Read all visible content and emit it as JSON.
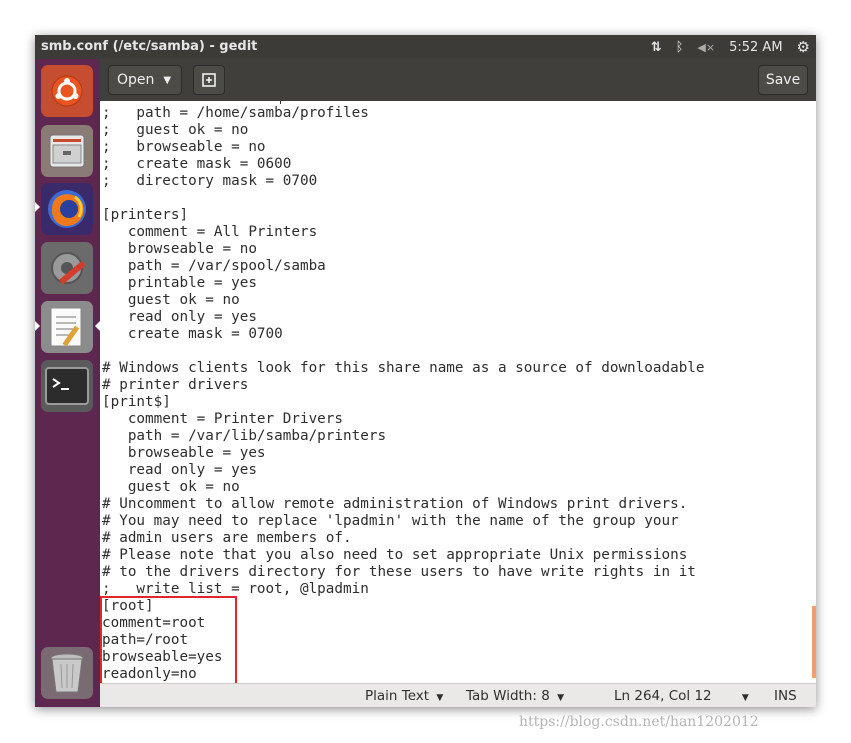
{
  "window": {
    "title": "smb.conf (/etc/samba) - gedit"
  },
  "tray": {
    "network_icon": "⇅",
    "bluetooth_icon": "ᛒ",
    "volume_icon": "◀×",
    "time": "5:52 AM",
    "settings_icon": "⚙"
  },
  "launcher": {
    "items": [
      "ubuntu-dash",
      "files",
      "firefox",
      "system-settings",
      "text-editor",
      "terminal",
      "trash"
    ]
  },
  "header": {
    "open_label": "Open",
    "save_label": "Save"
  },
  "editor": {
    "lines": [
      ";   path = /home/samba/profiles",
      ";   guest ok = no",
      ";   browseable = no",
      ";   create mask = 0600",
      ";   directory mask = 0700",
      "",
      "[printers]",
      "   comment = All Printers",
      "   browseable = no",
      "   path = /var/spool/samba",
      "   printable = yes",
      "   guest ok = no",
      "   read only = yes",
      "   create mask = 0700",
      "",
      "# Windows clients look for this share name as a source of downloadable",
      "# printer drivers",
      "[print$]",
      "   comment = Printer Drivers",
      "   path = /var/lib/samba/printers",
      "   browseable = yes",
      "   read only = yes",
      "   guest ok = no",
      "# Uncomment to allow remote administration of Windows print drivers.",
      "# You may need to replace 'lpadmin' with the name of the group your",
      "# admin users are members of.",
      "# Please note that you also need to set appropriate Unix permissions",
      "# to the drivers directory for these users to have write rights in it",
      ";   write list = root, @lpadmin",
      "[root]",
      "comment=root",
      "path=/root",
      "browseable=yes",
      "readonly=no"
    ]
  },
  "status": {
    "language": "Plain Text",
    "tab_width": "Tab Width: 8",
    "position": "Ln 264, Col 12",
    "mode": "INS"
  },
  "watermark": "https://blog.csdn.net/han1202012"
}
